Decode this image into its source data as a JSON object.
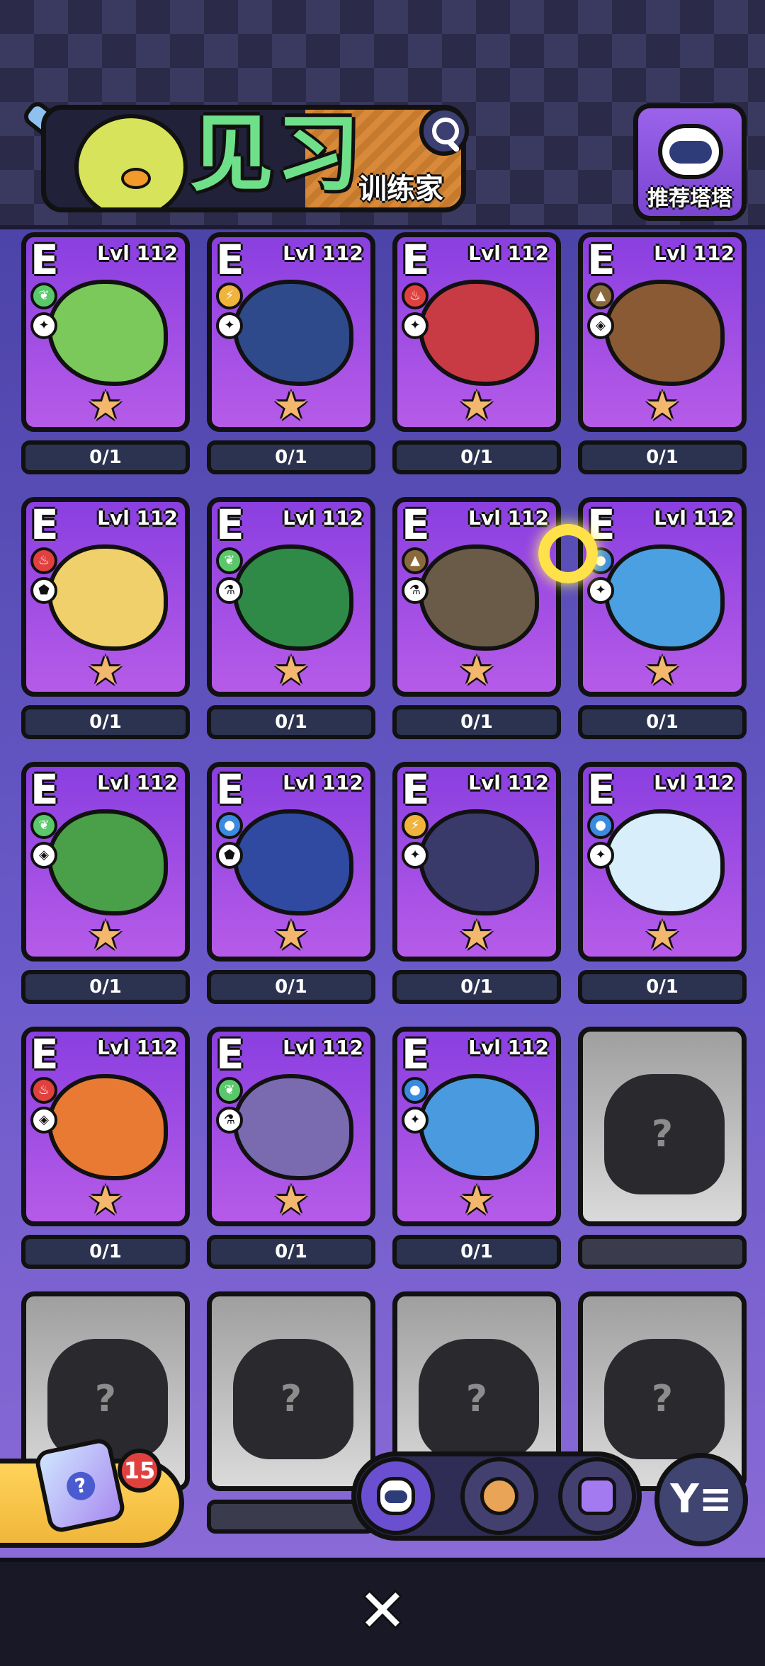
{
  "header": {
    "title": "见习",
    "subtitle": "训练家",
    "recommend_label": "推荐塔塔"
  },
  "cards": [
    {
      "tier": "E",
      "level": "Lvl 112",
      "element": "grass",
      "role": "sword",
      "color": "#5ac86a",
      "count": "0/1"
    },
    {
      "tier": "E",
      "level": "Lvl 112",
      "element": "electric",
      "role": "sword",
      "color": "#f0b43c",
      "count": "0/1"
    },
    {
      "tier": "E",
      "level": "Lvl 112",
      "element": "fire",
      "role": "sword",
      "color": "#e0413f",
      "count": "0/1"
    },
    {
      "tier": "E",
      "level": "Lvl 112",
      "element": "earth",
      "role": "eye",
      "color": "#8a6a3c",
      "count": "0/1"
    },
    {
      "tier": "E",
      "level": "Lvl 112",
      "element": "fire",
      "role": "shield",
      "color": "#e0413f",
      "count": "0/1"
    },
    {
      "tier": "E",
      "level": "Lvl 112",
      "element": "grass",
      "role": "potion",
      "color": "#5ac86a",
      "count": "0/1"
    },
    {
      "tier": "E",
      "level": "Lvl 112",
      "element": "earth",
      "role": "potion",
      "color": "#8a6a3c",
      "count": "0/1"
    },
    {
      "tier": "E",
      "level": "Lvl 112",
      "element": "water",
      "role": "sword",
      "color": "#3a8ae0",
      "count": "0/1"
    },
    {
      "tier": "E",
      "level": "Lvl 112",
      "element": "grass",
      "role": "eye",
      "color": "#5ac86a",
      "count": "0/1"
    },
    {
      "tier": "E",
      "level": "Lvl 112",
      "element": "water",
      "role": "shield",
      "color": "#3a8ae0",
      "count": "0/1"
    },
    {
      "tier": "E",
      "level": "Lvl 112",
      "element": "electric",
      "role": "sword",
      "color": "#f0b43c",
      "count": "0/1"
    },
    {
      "tier": "E",
      "level": "Lvl 112",
      "element": "water",
      "role": "sword",
      "color": "#3a8ae0",
      "count": "0/1"
    },
    {
      "tier": "E",
      "level": "Lvl 112",
      "element": "fire",
      "role": "eye",
      "color": "#e0413f",
      "count": "0/1"
    },
    {
      "tier": "E",
      "level": "Lvl 112",
      "element": "grass",
      "role": "potion",
      "color": "#5ac86a",
      "count": "0/1"
    },
    {
      "tier": "E",
      "level": "Lvl 112",
      "element": "water",
      "role": "sword",
      "color": "#3a8ae0",
      "count": "0/1"
    }
  ],
  "locked_cards": [
    {
      "mark": "?"
    },
    {
      "mark": "?"
    },
    {
      "mark": "?"
    },
    {
      "mark": "?"
    },
    {
      "mark": "?"
    }
  ],
  "gift": {
    "badge": "15"
  },
  "filter_icon": "filter-icon",
  "close_icon": "close-icon"
}
